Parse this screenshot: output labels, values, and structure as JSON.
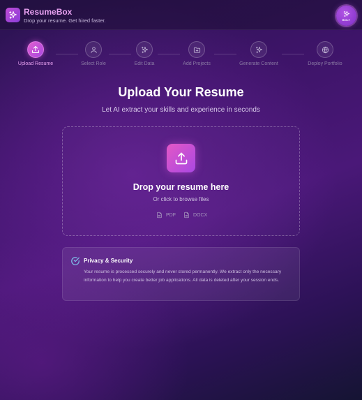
{
  "header": {
    "brand_title": "ResumeBox",
    "brand_subtitle": "Drop your resume. Get hired faster.",
    "logo_icon": "sparkles-icon",
    "badge_label": "BOLT"
  },
  "steps": [
    {
      "label": "Upload Resume",
      "icon": "upload-icon",
      "active": true
    },
    {
      "label": "Select Role",
      "icon": "user-icon",
      "active": false
    },
    {
      "label": "Edit Data",
      "icon": "sparkles-icon",
      "active": false
    },
    {
      "label": "Add Projects",
      "icon": "folder-plus-icon",
      "active": false
    },
    {
      "label": "Generate Content",
      "icon": "sparkles-icon",
      "active": false
    },
    {
      "label": "Deploy Portfolio",
      "icon": "globe-icon",
      "active": false
    }
  ],
  "main": {
    "title": "Upload Your Resume",
    "subtitle": "Let AI extract your skills and experience in seconds"
  },
  "dropzone": {
    "title": "Drop your resume here",
    "subtitle": "Or click to browse files",
    "file_types": [
      "PDF",
      "DOCX"
    ]
  },
  "privacy": {
    "title": "Privacy & Security",
    "body": "Your resume is processed securely and never stored permanently. We extract only the necessary information to help you create better job applications. All data is deleted after your session ends."
  },
  "colors": {
    "accent": "#e05ed0",
    "accent_secondary": "#a848e0",
    "brand_text": "#e7a0f0",
    "background_dark": "#2a1350",
    "privacy_check": "#7fb9e6"
  }
}
